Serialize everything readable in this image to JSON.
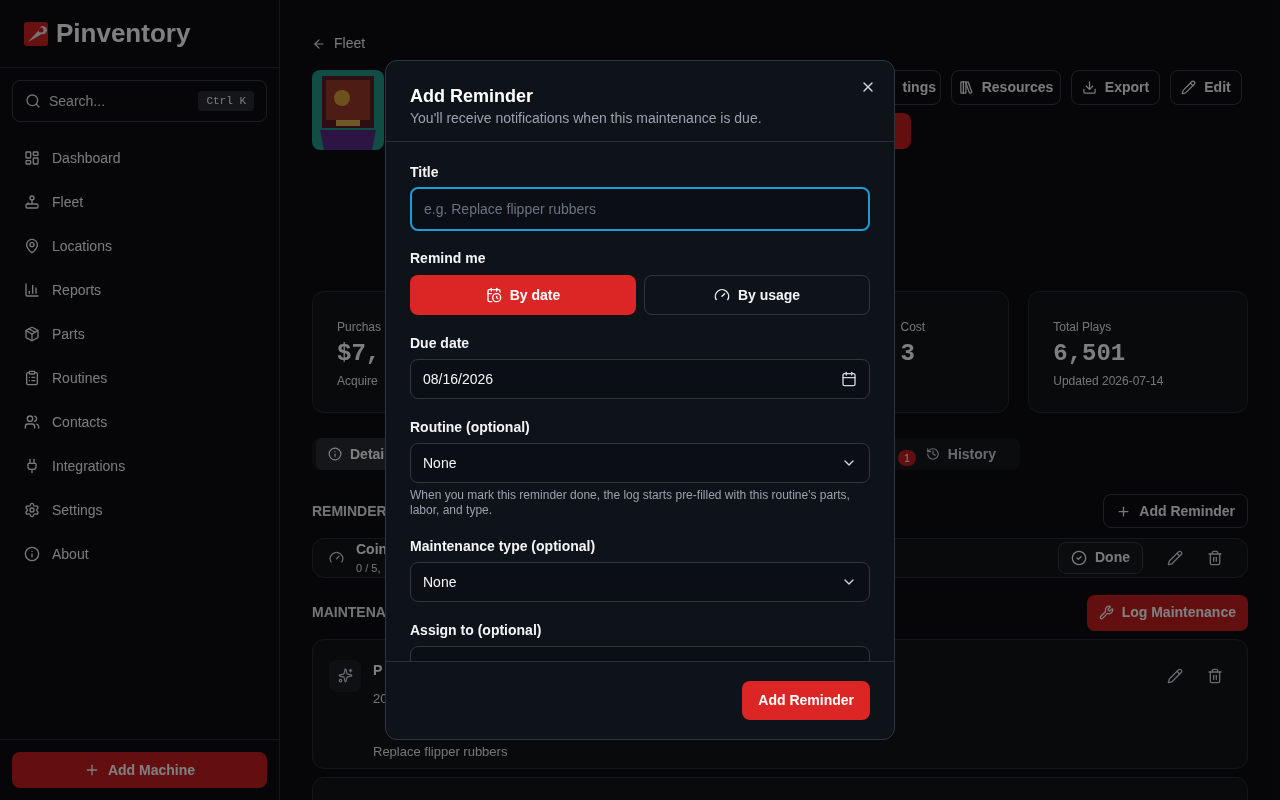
{
  "sidebar": {
    "brand": "Pinventory",
    "search": {
      "placeholder": "Search...",
      "shortcut": "Ctrl K"
    },
    "items": [
      {
        "label": "Dashboard"
      },
      {
        "label": "Fleet"
      },
      {
        "label": "Locations"
      },
      {
        "label": "Reports"
      },
      {
        "label": "Parts"
      },
      {
        "label": "Routines"
      },
      {
        "label": "Contacts"
      },
      {
        "label": "Integrations"
      },
      {
        "label": "Settings"
      },
      {
        "label": "About"
      }
    ],
    "add_button": "Add Machine"
  },
  "page": {
    "back": "Fleet",
    "header_buttons": [
      "tings",
      "Resources",
      "Export",
      "Edit"
    ],
    "stats": [
      {
        "label": "Purchas",
        "value": "$7,",
        "sub": "Acquire"
      },
      {
        "label": "Cost",
        "value": "3"
      },
      {
        "label": "Total Plays",
        "value": "6,501",
        "sub": "Updated 2026-07-14"
      }
    ],
    "tabs": [
      {
        "label": "Detai",
        "selected": true
      },
      {
        "label": "History",
        "selected": false
      }
    ],
    "tab_badge": "1",
    "reminders": {
      "heading": "REMINDER",
      "add": "Add Reminder",
      "item": {
        "title": "Coin",
        "usage": "0 / 5,",
        "done": "Done"
      }
    },
    "maintenance": {
      "heading": "MAINTENA",
      "log": "Log Maintenance",
      "item": {
        "title": "P",
        "date": "20",
        "note": "Replace flipper rubbers"
      }
    }
  },
  "dialog": {
    "title": "Add Reminder",
    "subtitle": "You'll receive notifications when this maintenance is due.",
    "title_field": {
      "label": "Title",
      "placeholder": "e.g. Replace flipper rubbers",
      "focused": true
    },
    "remind": {
      "label": "Remind me",
      "options": [
        {
          "label": "By date",
          "selected": true
        },
        {
          "label": "By usage",
          "selected": false
        }
      ]
    },
    "fields": [
      {
        "kind": "date",
        "label": "Due date",
        "value": "08/16/2026"
      },
      {
        "kind": "select",
        "label": "Routine (optional)",
        "value": "None",
        "help": "When you mark this reminder done, the log starts pre-filled with this routine's parts, labor, and type."
      },
      {
        "kind": "select",
        "label": "Maintenance type (optional)",
        "value": "None"
      },
      {
        "kind": "select",
        "label": "Assign to (optional)"
      }
    ],
    "submit": "Add Reminder"
  }
}
